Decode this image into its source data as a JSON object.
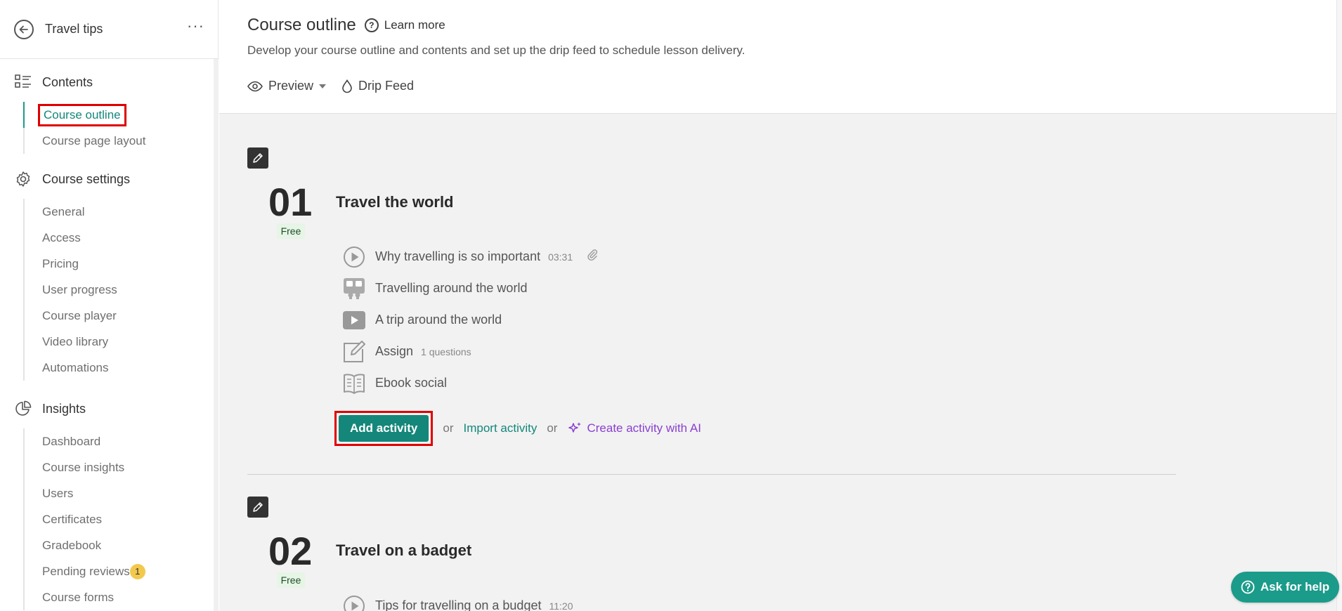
{
  "sidebar": {
    "course_title": "Travel tips",
    "sections": [
      {
        "title": "Contents",
        "icon": "list-icon",
        "items": [
          {
            "label": "Course outline",
            "active": true
          },
          {
            "label": "Course page layout"
          }
        ]
      },
      {
        "title": "Course settings",
        "icon": "gear-icon",
        "items": [
          {
            "label": "General"
          },
          {
            "label": "Access"
          },
          {
            "label": "Pricing"
          },
          {
            "label": "User progress"
          },
          {
            "label": "Course player"
          },
          {
            "label": "Video library"
          },
          {
            "label": "Automations"
          }
        ]
      },
      {
        "title": "Insights",
        "icon": "pie-chart-icon",
        "items": [
          {
            "label": "Dashboard"
          },
          {
            "label": "Course insights"
          },
          {
            "label": "Users"
          },
          {
            "label": "Certificates"
          },
          {
            "label": "Gradebook"
          },
          {
            "label": "Pending reviews",
            "badge": "1"
          },
          {
            "label": "Course forms"
          }
        ]
      }
    ]
  },
  "header": {
    "title": "Course outline",
    "learn_more": "Learn more",
    "subtitle": "Develop your course outline and contents and set up the drip feed to schedule lesson delivery.",
    "preview_label": "Preview",
    "drip_label": "Drip Feed"
  },
  "modules": [
    {
      "number": "01",
      "badge": "Free",
      "title": "Travel the world",
      "lessons": [
        {
          "icon": "play-circle-icon",
          "title": "Why travelling is so important",
          "meta": "03:31",
          "attachment": true
        },
        {
          "icon": "presentation-icon",
          "title": "Travelling around the world",
          "meta": ""
        },
        {
          "icon": "video-icon",
          "title": "A trip around the world",
          "meta": ""
        },
        {
          "icon": "edit-note-icon",
          "title": "Assign",
          "meta": "1 questions"
        },
        {
          "icon": "ebook-icon",
          "title": "Ebook social",
          "meta": ""
        }
      ],
      "actions": {
        "add": "Add activity",
        "or": "or",
        "import": "Import activity",
        "ai": "Create activity with AI"
      }
    },
    {
      "number": "02",
      "badge": "Free",
      "title": "Travel on a badget",
      "lessons": [
        {
          "icon": "play-circle-icon",
          "title": "Tips for travelling on a budget",
          "meta": "11:20"
        }
      ]
    }
  ],
  "help_button": "Ask for help",
  "colors": {
    "accent": "#14877a",
    "ai": "#8a3fd1",
    "highlight": "#e00000",
    "badge": "#f2c94c"
  }
}
